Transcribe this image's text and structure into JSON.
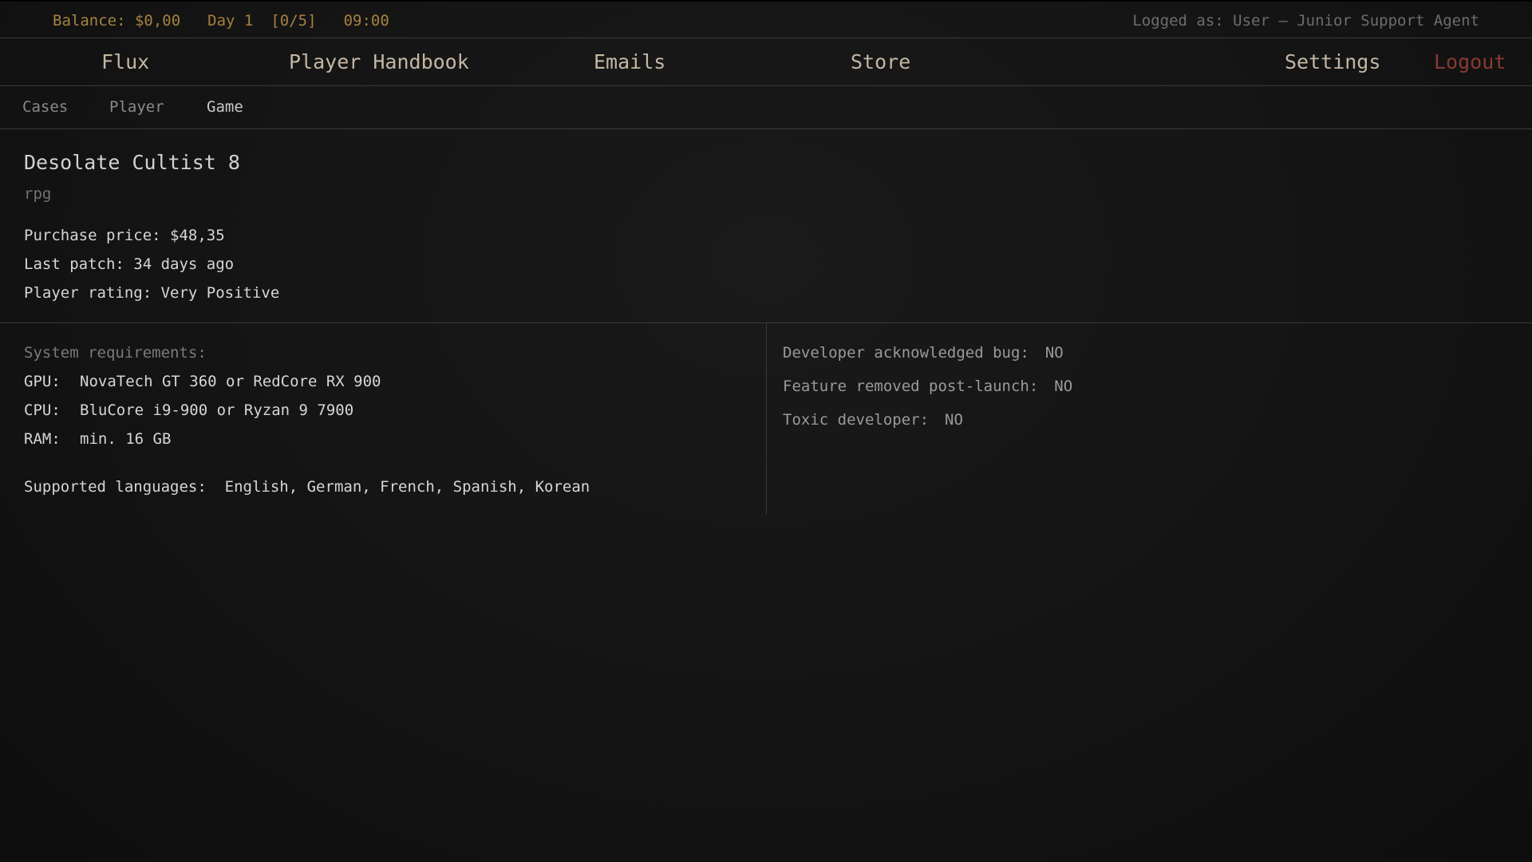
{
  "status": {
    "balance": "Balance: $0,00",
    "day": "Day 1",
    "progress": "[0/5]",
    "time": "09:00",
    "logged_as": "Logged as: User — Junior Support Agent"
  },
  "nav": {
    "flux": "Flux",
    "handbook": "Player Handbook",
    "emails": "Emails",
    "store": "Store",
    "settings": "Settings",
    "logout": "Logout"
  },
  "subnav": {
    "cases": "Cases",
    "player": "Player",
    "game": "Game"
  },
  "game": {
    "title": "Desolate Cultist 8",
    "genre": "rpg",
    "purchase_price": "Purchase price: $48,35",
    "last_patch": "Last patch: 34 days ago",
    "player_rating": "Player rating: Very Positive"
  },
  "requirements": {
    "label": "System requirements:",
    "gpu_key": "GPU:",
    "gpu": "NovaTech GT 360 or RedCore RX 900",
    "cpu_key": "CPU:",
    "cpu": "BluCore i9-900 or Ryzan 9 7900",
    "ram_key": "RAM:",
    "ram": "min. 16 GB",
    "languages_key": "Supported languages:",
    "languages": "English, German, French, Spanish, Korean"
  },
  "flags": {
    "bug_key": "Developer acknowledged bug:",
    "bug": "NO",
    "feature_key": "Feature removed post-launch:",
    "feature": "NO",
    "toxic_key": "Toxic developer:",
    "toxic": "NO"
  },
  "colors": {
    "accent": "#a6813f",
    "logout": "#8a3a33",
    "background": "#151515"
  }
}
